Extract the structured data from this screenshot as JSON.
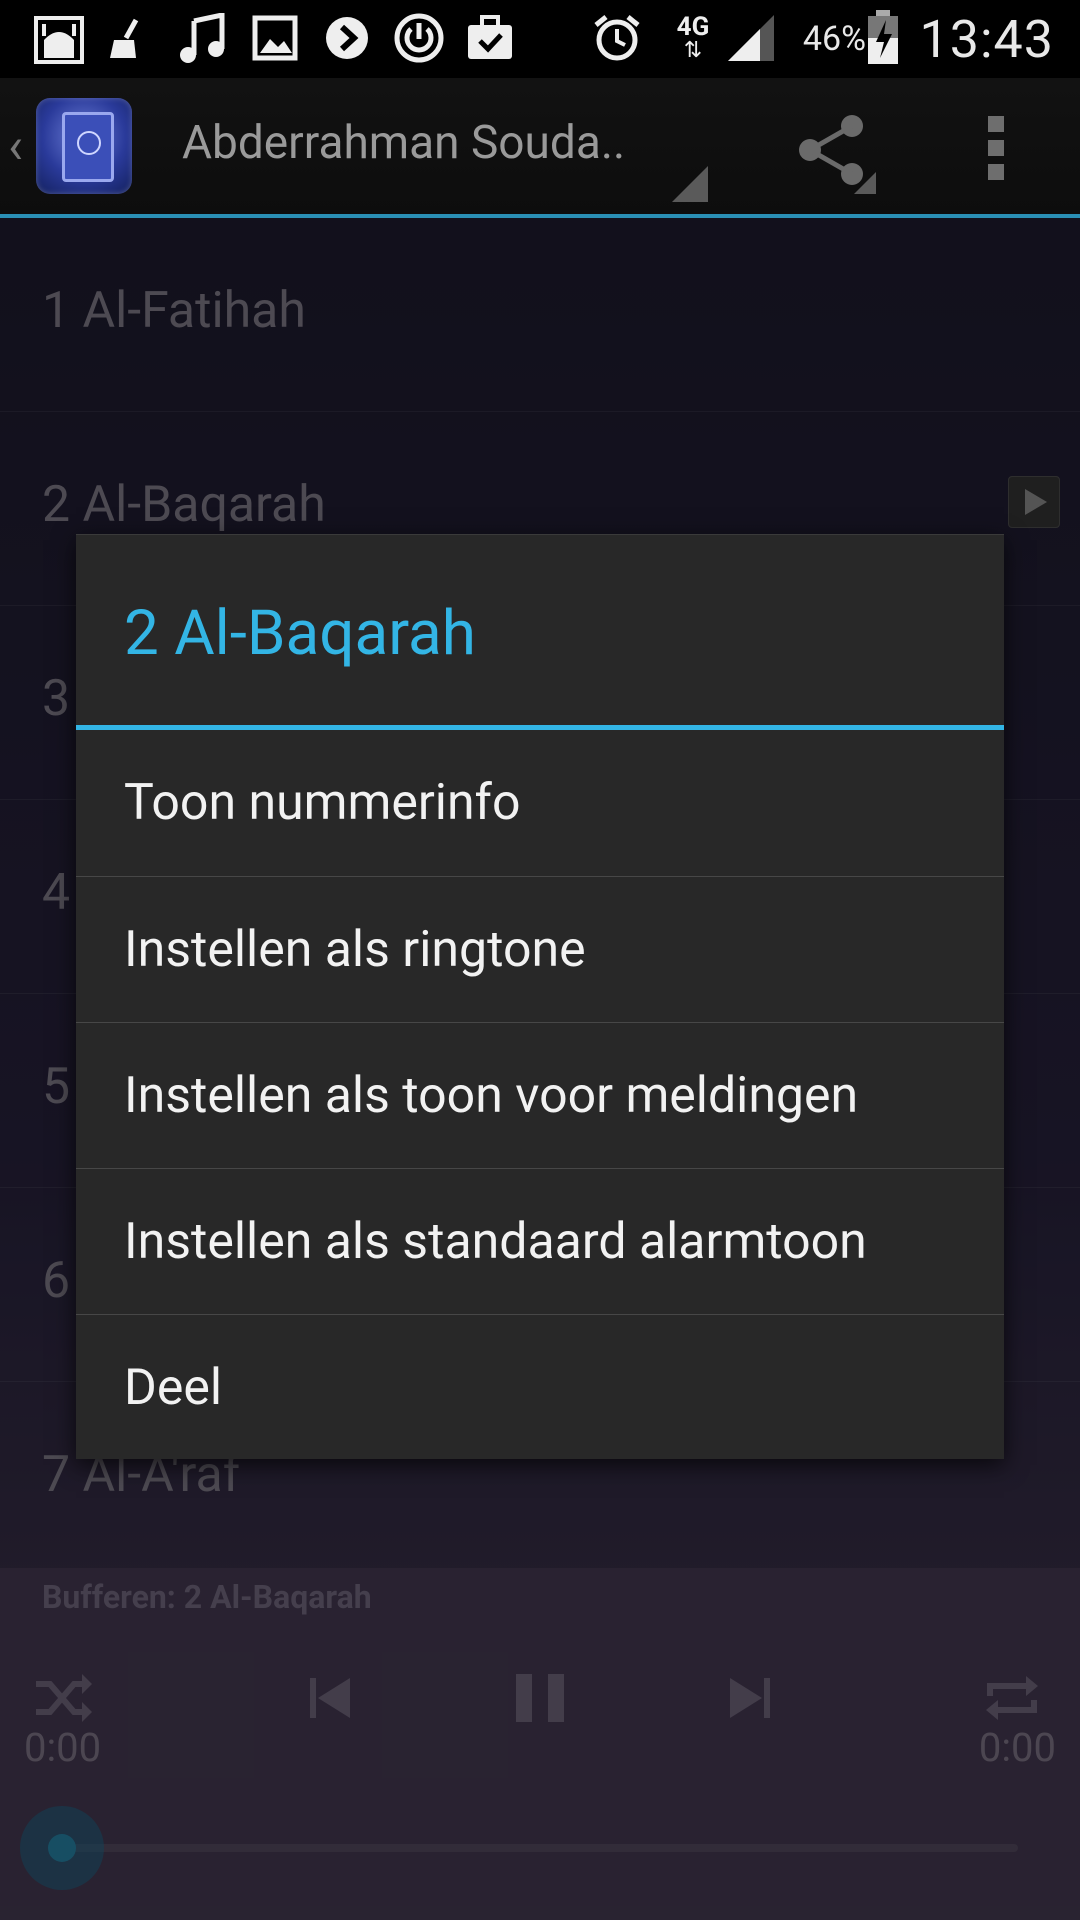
{
  "status_bar": {
    "battery_percent": "46%",
    "time": "13:43",
    "network": "4G",
    "icons": [
      "mosque-icon",
      "broom-icon",
      "music-note-icon",
      "image-icon",
      "plex-icon",
      "power-circle-icon",
      "briefcase-check-icon",
      "alarm-icon",
      "signal-icon",
      "battery-charging-icon"
    ]
  },
  "action_bar": {
    "title": "Abderrahman Souda..",
    "icons": [
      "back-chevron-icon",
      "quran-app-logo",
      "share-icon",
      "overflow-menu-icon"
    ]
  },
  "list": {
    "items": [
      {
        "label": "1 Al-Fatihah"
      },
      {
        "label": "2 Al-Baqarah"
      },
      {
        "label": "3"
      },
      {
        "label": "4"
      },
      {
        "label": "5"
      },
      {
        "label": "6"
      },
      {
        "label": "7 Al-A'raf"
      }
    ]
  },
  "player": {
    "status_text": "Bufferen: 2 Al-Baqarah",
    "elapsed": "0:00",
    "duration": "0:00",
    "progress": 0
  },
  "dialog": {
    "title": "2 Al-Baqarah",
    "items": [
      {
        "label": "Toon nummerinfo"
      },
      {
        "label": "Instellen als ringtone"
      },
      {
        "label": "Instellen als toon voor meldingen"
      },
      {
        "label": "Instellen als standaard alarmtoon"
      },
      {
        "label": "Deel"
      }
    ]
  },
  "colors": {
    "accent": "#33b5e5",
    "dialog_bg": "#282828",
    "list_text": "#8c8796"
  }
}
